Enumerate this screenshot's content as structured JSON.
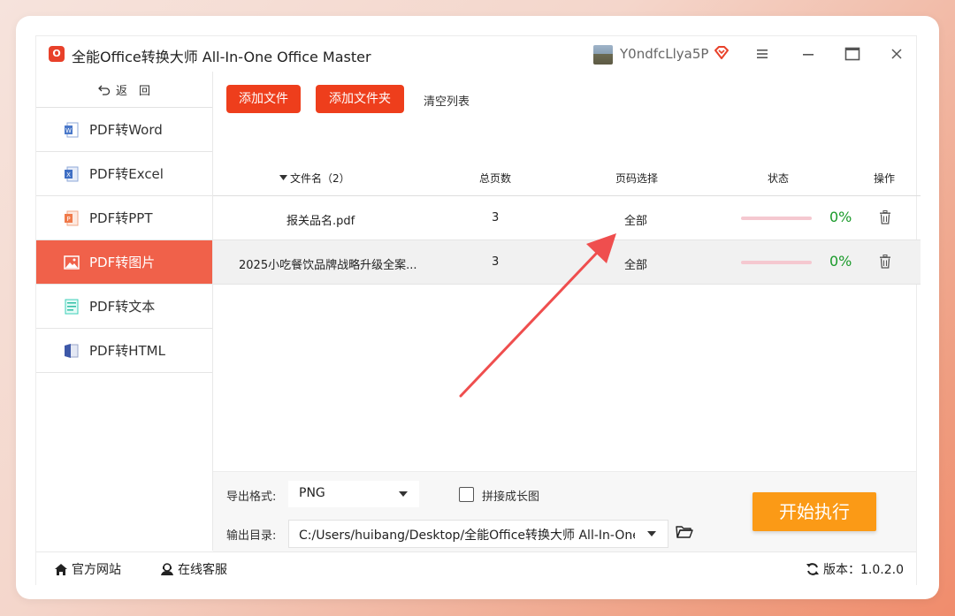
{
  "window": {
    "title": "全能Office转换大师 All-In-One Office Master",
    "logo_letter": "O",
    "user_name": "Y0ndfcLlya5P"
  },
  "sidebar": {
    "back_label": "返　回",
    "items": [
      {
        "label": "PDF转Word",
        "icon": "word-icon"
      },
      {
        "label": "PDF转Excel",
        "icon": "excel-icon"
      },
      {
        "label": "PDF转PPT",
        "icon": "ppt-icon"
      },
      {
        "label": "PDF转图片",
        "icon": "image-icon",
        "active": true
      },
      {
        "label": "PDF转文本",
        "icon": "text-icon"
      },
      {
        "label": "PDF转HTML",
        "icon": "html-icon"
      }
    ]
  },
  "toolbar": {
    "add_file": "添加文件",
    "add_folder": "添加文件夹",
    "clear_list": "清空列表"
  },
  "table": {
    "headers": {
      "filename": "文件名（2）",
      "pages": "总页数",
      "page_select": "页码选择",
      "status": "状态",
      "actions": "操作"
    },
    "rows": [
      {
        "filename": "报关品名.pdf",
        "pages": "3",
        "page_select": "全部",
        "progress": 0,
        "percent": "0%"
      },
      {
        "filename": "2025小吃餐饮品牌战略升级全案...",
        "pages": "3",
        "page_select": "全部",
        "progress": 0,
        "percent": "0%"
      }
    ]
  },
  "output": {
    "format_label": "导出格式:",
    "format_value": "PNG",
    "merge_label": "拼接成长图",
    "merge_checked": false,
    "dir_label": "输出目录:",
    "dir_value": "C:/Users/huibang/Desktop/全能Office转换大师 All-In-One",
    "start_button": "开始执行"
  },
  "footer": {
    "website": "官方网站",
    "support": "在线客服",
    "version": "版本：1.0.2.0"
  },
  "colors": {
    "accent_red": "#ee3e1c",
    "active_nav": "#f0614a",
    "start_orange": "#fb9a16",
    "percent_green": "#1a9a2a",
    "annotation_arrow": "#ef4e4e"
  }
}
